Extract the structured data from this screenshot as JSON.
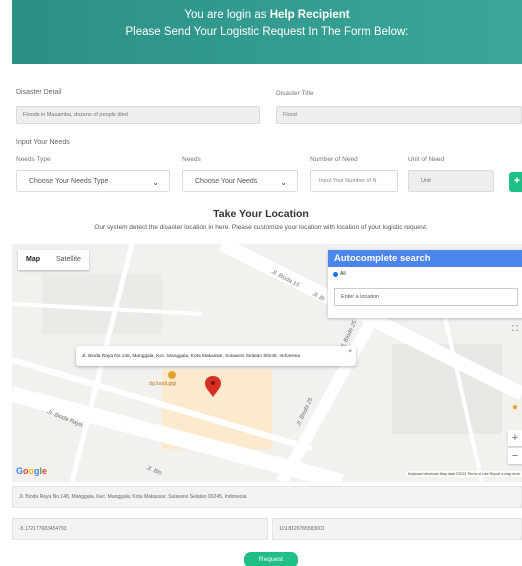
{
  "banner": {
    "line1_prefix": "You are login as ",
    "line1_role": "Help Recipient",
    "line2": "Please Send Your Logistic Request In The Form Below:"
  },
  "form": {
    "disaster_detail_label": "Disaster Detail",
    "disaster_detail_value": "Floods in Masamba, dozens of people died",
    "disaster_title_label": "Disaster Title",
    "disaster_title_value": "Flood",
    "input_needs_label": "Input Your Needs",
    "needs_type_label": "Needs Type",
    "needs_type_value": "Choose Your Needs Type",
    "needs_label": "Needs",
    "needs_value": "Choose Your Needs",
    "number_label": "Number of Need",
    "number_placeholder": "Input Your Number of N",
    "unit_label": "Unit of Need",
    "unit_value": "Unit",
    "add_label": "+"
  },
  "location": {
    "title": "Take Your Location",
    "subtitle": "Our system detect the disaster location in here. Please customize your location with location of your logistic request."
  },
  "map": {
    "tab_map": "Map",
    "tab_satellite": "Satellite",
    "autocomplete_title": "Autocomplete search",
    "radio_all": "All",
    "search_placeholder": "Enter a location",
    "info_address": "Jl. Bioda Raya No.148, Manggala, Kec. Manggala, Kota Makassar, Sulawesi Selatan 90245, Indonesia",
    "info_close": "×",
    "street_top": "Jl. Bioda 15",
    "street_top2": "Jl. Bi",
    "street_right": "Jl. Bioda 25",
    "street_right2": "Jl. Bioda 25",
    "street_left": "Jl. Bioda Raya",
    "street_bottom": "Jl. Bio",
    "poi_label": "dg.kaidi.gigi",
    "fullscreen": "⛶",
    "zoom_in": "+",
    "zoom_out": "−",
    "google": [
      "G",
      "o",
      "o",
      "g",
      "l",
      "e"
    ],
    "footer": "Keyboard shortcuts   Map data ©2021   Terms of Use   Report a map error"
  },
  "result": {
    "address": "Jl. Bioda Raya No.148, Manggala, Kec. Manggala, Kota Makassar, Sulawesi Selatan 90245, Indonesia",
    "lat": "-5.172177683454793",
    "lng": "119.8126765583001",
    "request_label": "Request"
  },
  "colors": {
    "accent": "#1fbf86",
    "banner": "#2c8f86",
    "autocomplete": "#4c86ec",
    "pin": "#d93025"
  }
}
